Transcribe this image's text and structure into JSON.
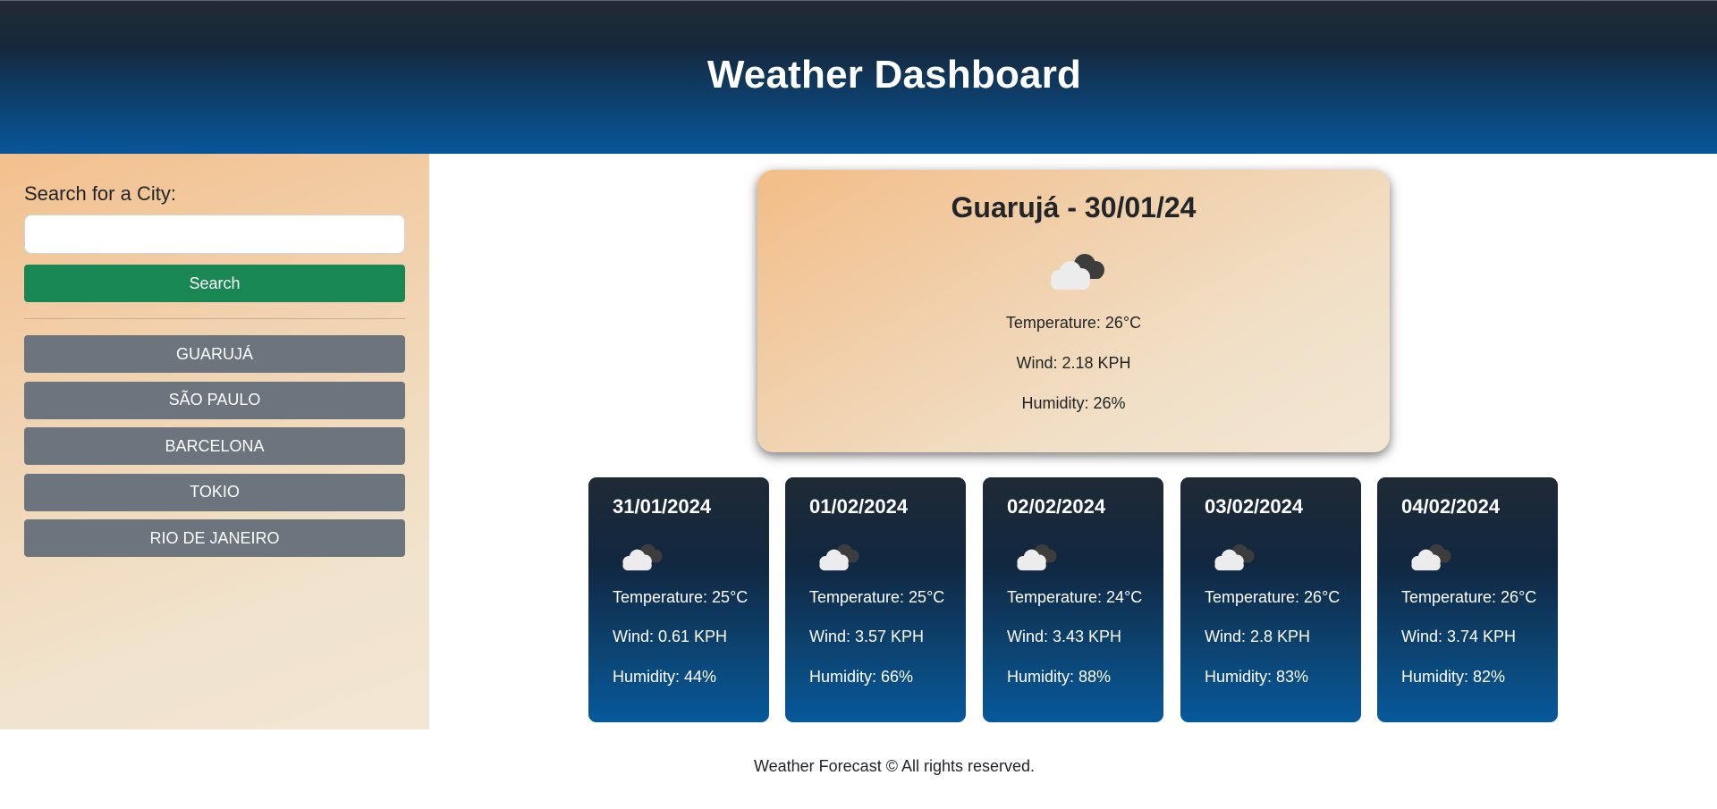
{
  "header": {
    "title": "Weather Dashboard"
  },
  "sidebar": {
    "search_label": "Search for a City:",
    "search_value": "",
    "search_placeholder": "",
    "search_button": "Search",
    "cities": [
      "GUARUJÁ",
      "SÃO PAULO",
      "BARCELONA",
      "TOKIO",
      "RIO DE JANEIRO"
    ]
  },
  "current": {
    "title": "Guarujá - 30/01/24",
    "icon": "broken-clouds-icon",
    "temperature": "Temperature: 26°C",
    "wind": "Wind: 2.18 KPH",
    "humidity": "Humidity: 26%"
  },
  "forecast": [
    {
      "date": "31/01/2024",
      "icon": "broken-clouds-icon",
      "temperature": "Temperature: 25°C",
      "wind": "Wind: 0.61 KPH",
      "humidity": "Humidity: 44%"
    },
    {
      "date": "01/02/2024",
      "icon": "broken-clouds-icon",
      "temperature": "Temperature: 25°C",
      "wind": "Wind: 3.57 KPH",
      "humidity": "Humidity: 66%"
    },
    {
      "date": "02/02/2024",
      "icon": "broken-clouds-icon",
      "temperature": "Temperature: 24°C",
      "wind": "Wind: 3.43 KPH",
      "humidity": "Humidity: 88%"
    },
    {
      "date": "03/02/2024",
      "icon": "broken-clouds-icon",
      "temperature": "Temperature: 26°C",
      "wind": "Wind: 2.8 KPH",
      "humidity": "Humidity: 83%"
    },
    {
      "date": "04/02/2024",
      "icon": "broken-clouds-icon",
      "temperature": "Temperature: 26°C",
      "wind": "Wind: 3.74 KPH",
      "humidity": "Humidity: 82%"
    }
  ],
  "footer": {
    "text": "Weather Forecast © All rights reserved."
  },
  "colors": {
    "header_top": "#232b33",
    "header_bottom": "#07569a",
    "search_button": "#198754",
    "city_button": "#6c757d",
    "card_top": "#1f2a35",
    "card_bottom": "#07599c"
  }
}
